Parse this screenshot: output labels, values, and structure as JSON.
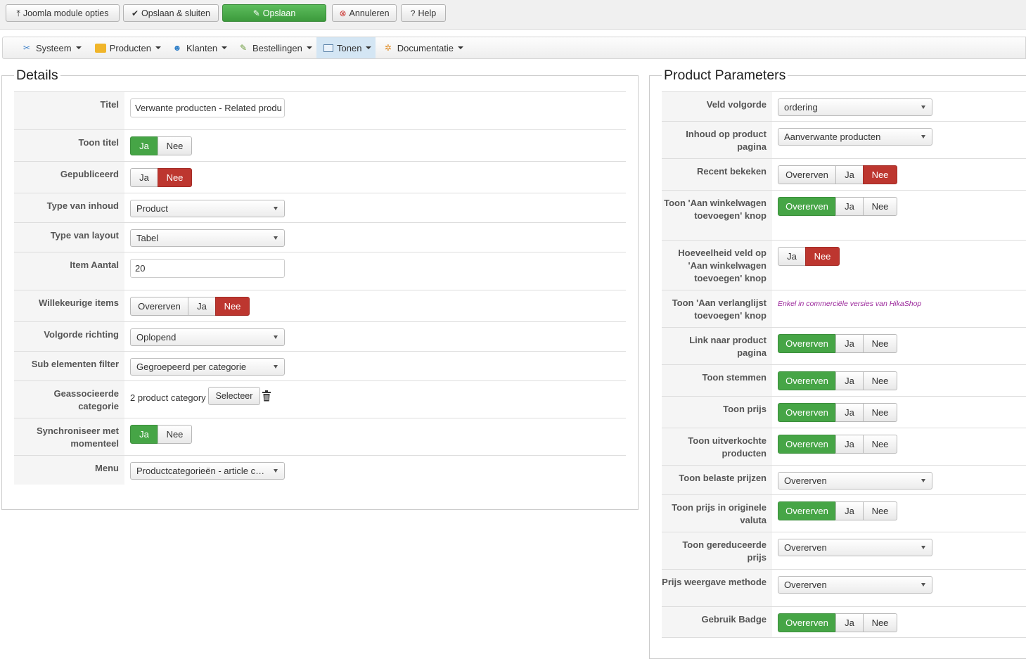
{
  "toolbar": {
    "joomla_options": "Joomla module opties",
    "save_close": "Opslaan & sluiten",
    "save": "Opslaan",
    "cancel": "Annuleren",
    "help": "Help"
  },
  "menu": {
    "system": "Systeem",
    "products": "Producten",
    "customers": "Klanten",
    "orders": "Bestellingen",
    "display": "Tonen",
    "docs": "Documentatie"
  },
  "details": {
    "legend": "Details",
    "title_label": "Titel",
    "title_value": "Verwante producten - Related produ",
    "show_title_label": "Toon titel",
    "published_label": "Gepubliceerd",
    "content_type_label": "Type van inhoud",
    "content_type_value": "Product",
    "layout_type_label": "Type van layout",
    "layout_type_value": "Tabel",
    "item_count_label": "Item Aantal",
    "item_count_value": "20",
    "random_label": "Willekeurige items",
    "order_dir_label": "Volgorde richting",
    "order_dir_value": "Oplopend",
    "sub_filter_label": "Sub elementen filter",
    "sub_filter_value": "Gegroepeerd per categorie",
    "assoc_cat_label": "Geassocieerde categorie",
    "assoc_cat_value": "2 product category",
    "assoc_cat_button": "Selecteer",
    "sync_label": "Synchroniseer met momenteel",
    "menu_label": "Menu",
    "menu_value": "Productcategorieën - article c…"
  },
  "btn": {
    "inherit": "Overerven",
    "yes": "Ja",
    "no": "Nee"
  },
  "params": {
    "legend": "Product Parameters",
    "field_order_label": "Veld volgorde",
    "field_order_value": "ordering",
    "content_label": "Inhoud op product pagina",
    "content_value": "Aanverwante producten",
    "recent_label": "Recent bekeken",
    "add_cart_label": "Toon 'Aan winkelwagen toevoegen' knop",
    "qty_label": "Hoeveelheid veld op 'Aan winkelwagen toevoegen' knop",
    "wishlist_label": "Toon 'Aan verlanglijst toevoegen' knop",
    "wishlist_note": "Enkel in commerciële versies van HikaShop",
    "link_label": "Link naar product pagina",
    "votes_label": "Toon stemmen",
    "price_label": "Toon prijs",
    "soldout_label": "Toon uitverkochte producten",
    "taxed_label": "Toon belaste prijzen",
    "taxed_value": "Overerven",
    "orig_cur_label": "Toon prijs in originele valuta",
    "discount_label": "Toon gereduceerde prijs",
    "discount_value": "Overerven",
    "price_method_label": "Prijs weergave methode",
    "price_method_value": "Overerven",
    "badge_label": "Gebruik Badge"
  },
  "colors": {
    "green": "#46a546",
    "red": "#bd362f",
    "active_menu": "#d4e6f4"
  }
}
